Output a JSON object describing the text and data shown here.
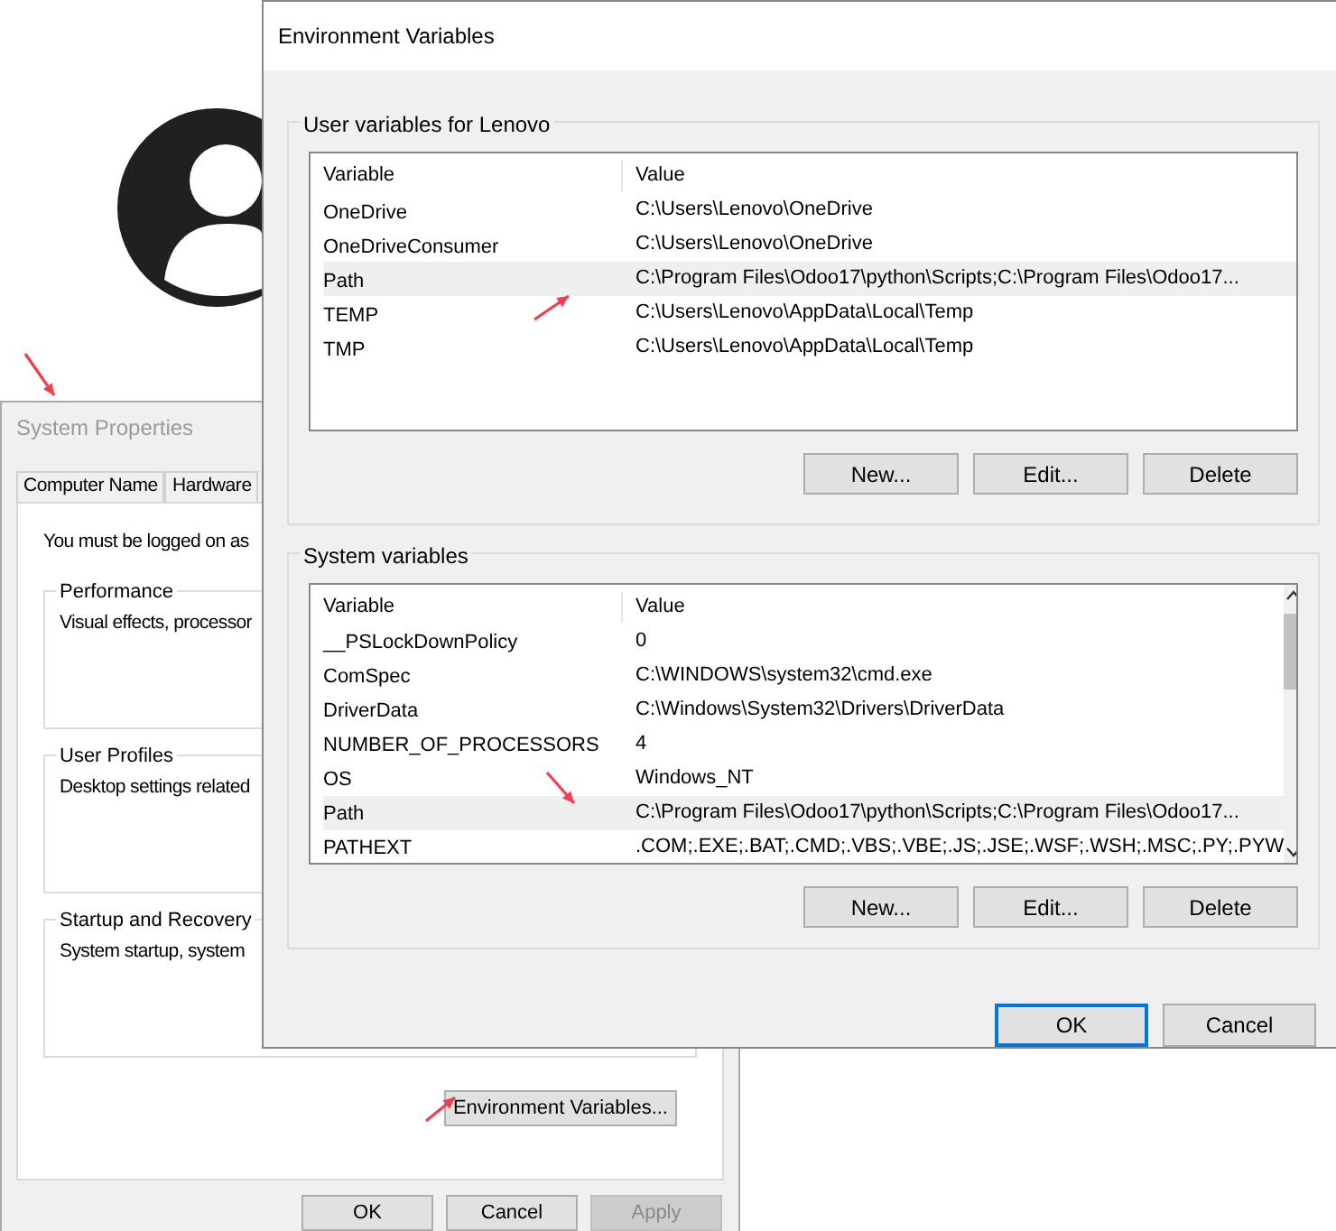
{
  "system_properties": {
    "title": "System Properties",
    "tabs": [
      {
        "label": "Computer Name",
        "selected": false
      },
      {
        "label": "Hardware",
        "selected": false
      }
    ],
    "intro": "You must be logged on as",
    "groups": [
      {
        "title": "Performance",
        "text": "Visual effects, processor"
      },
      {
        "title": "User Profiles",
        "text": "Desktop settings related"
      },
      {
        "title": "Startup and Recovery",
        "text": "System startup, system"
      }
    ],
    "environment_button": "Environment Variables...",
    "buttons": [
      {
        "label": "OK",
        "disabled": false
      },
      {
        "label": "Cancel",
        "disabled": false
      },
      {
        "label": "Apply",
        "disabled": true
      }
    ]
  },
  "environment_variables": {
    "title": "Environment Variables",
    "sections": [
      {
        "title": "User variables for Lenovo",
        "columns": [
          "Variable",
          "Value"
        ],
        "scrollbar": false,
        "rows": [
          {
            "variable": "OneDrive",
            "value": "C:\\Users\\Lenovo\\OneDrive",
            "highlighted": false
          },
          {
            "variable": "OneDriveConsumer",
            "value": "C:\\Users\\Lenovo\\OneDrive",
            "highlighted": false
          },
          {
            "variable": "Path",
            "value": "C:\\Program Files\\Odoo17\\python\\Scripts;C:\\Program Files\\Odoo17...",
            "highlighted": true
          },
          {
            "variable": "TEMP",
            "value": "C:\\Users\\Lenovo\\AppData\\Local\\Temp",
            "highlighted": false
          },
          {
            "variable": "TMP",
            "value": "C:\\Users\\Lenovo\\AppData\\Local\\Temp",
            "highlighted": false
          }
        ],
        "buttons": [
          "New...",
          "Edit...",
          "Delete"
        ]
      },
      {
        "title": "System variables",
        "columns": [
          "Variable",
          "Value"
        ],
        "scrollbar": true,
        "rows": [
          {
            "variable": "__PSLockDownPolicy",
            "value": "0",
            "highlighted": false
          },
          {
            "variable": "ComSpec",
            "value": "C:\\WINDOWS\\system32\\cmd.exe",
            "highlighted": false
          },
          {
            "variable": "DriverData",
            "value": "C:\\Windows\\System32\\Drivers\\DriverData",
            "highlighted": false
          },
          {
            "variable": "NUMBER_OF_PROCESSORS",
            "value": "4",
            "highlighted": false
          },
          {
            "variable": "OS",
            "value": "Windows_NT",
            "highlighted": false
          },
          {
            "variable": "Path",
            "value": "C:\\Program Files\\Odoo17\\python\\Scripts;C:\\Program Files\\Odoo17...",
            "highlighted": true
          },
          {
            "variable": "PATHEXT",
            "value": ".COM;.EXE;.BAT;.CMD;.VBS;.VBE;.JS;.JSE;.WSF;.WSH;.MSC;.PY;.PYW",
            "highlighted": false
          }
        ],
        "buttons": [
          "New...",
          "Edit...",
          "Delete"
        ]
      }
    ],
    "footer_buttons": [
      {
        "label": "OK",
        "default": true
      },
      {
        "label": "Cancel",
        "default": false
      }
    ]
  }
}
